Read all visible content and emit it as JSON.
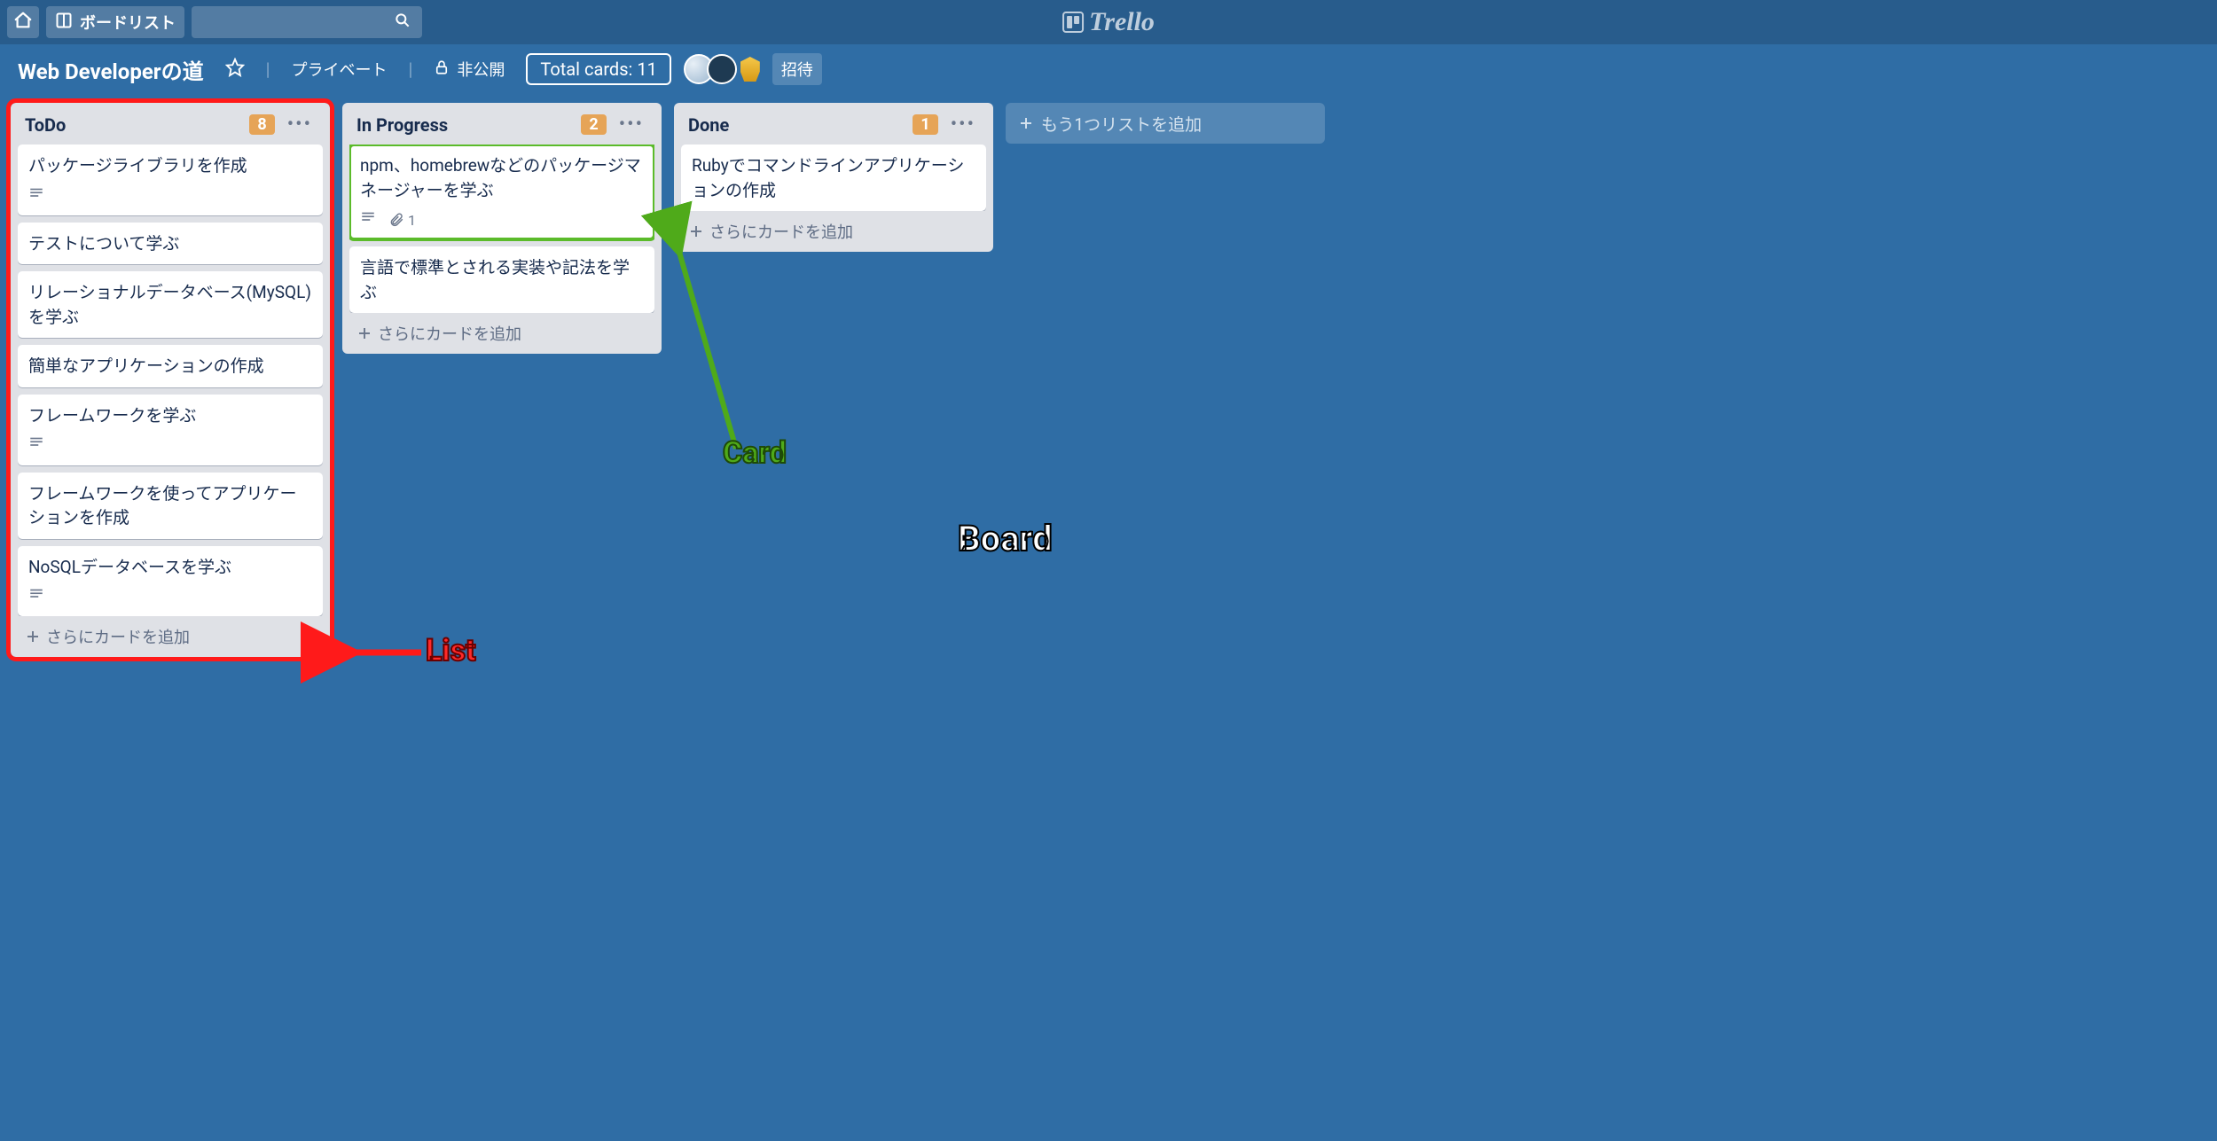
{
  "header": {
    "boards_button": "ボードリスト",
    "logo_text": "Trello"
  },
  "board": {
    "title": "Web Developerの道",
    "visibility_team": "プライベート",
    "visibility_public": "非公開",
    "total_cards_label": "Total cards: 11",
    "invite_label": "招待"
  },
  "lists": [
    {
      "title": "ToDo",
      "count": "8",
      "highlight": "red",
      "cards": [
        {
          "text": "パッケージライブラリを作成",
          "has_desc": true
        },
        {
          "text": "テストについて学ぶ"
        },
        {
          "text": "リレーショナルデータベース(MySQL)を学ぶ"
        },
        {
          "text": "簡単なアプリケーションの作成"
        },
        {
          "text": "フレームワークを学ぶ",
          "has_desc": true
        },
        {
          "text": "フレームワークを使ってアプリケーションを作成"
        },
        {
          "text": "NoSQLデータベースを学ぶ",
          "has_desc": true
        }
      ],
      "add_card": "さらにカードを追加"
    },
    {
      "title": "In Progress",
      "count": "2",
      "cards": [
        {
          "text": "npm、homebrewなどのパッケージマネージャーを学ぶ",
          "has_desc": true,
          "attach_count": "1",
          "highlight": "green"
        },
        {
          "text": "言語で標準とされる実装や記法を学ぶ"
        }
      ],
      "add_card": "さらにカードを追加"
    },
    {
      "title": "Done",
      "count": "1",
      "cards": [
        {
          "text": "Rubyでコマンドラインアプリケーションの作成"
        }
      ],
      "add_card": "さらにカードを追加"
    }
  ],
  "add_list_label": "もう1つリストを追加",
  "annotations": {
    "card": "Card",
    "list": "List",
    "board": "Board"
  }
}
